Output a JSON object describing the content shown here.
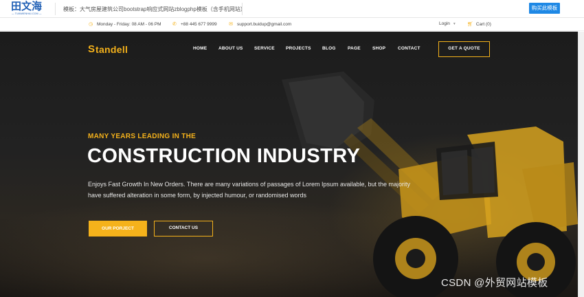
{
  "preview": {
    "logo_text": "田文海",
    "logo_sub": "— TIANWENHAI.COM —",
    "title": "模板：大气房屋建筑公司bootstrap响应式网站zblogphp模板（含手机网站）",
    "buy_label": "购买此模板"
  },
  "info": {
    "hours": "Monday - Friday: 08 AM - 06 PM",
    "phone": "+88 445 677 9999",
    "email": "support.buidup@gmail.com",
    "login": "Login",
    "cart": "Cart (0)"
  },
  "brand": {
    "name": "tandell",
    "initial": "S"
  },
  "nav": {
    "items": [
      "HOME",
      "ABOUT US",
      "SERVICE",
      "PROJECTS",
      "BLOG",
      "PAGE",
      "SHOP",
      "CONTACT"
    ]
  },
  "quote_label": "GET A QUOTE",
  "hero": {
    "eyebrow": "MANY YEARS LEADING IN THE",
    "headline": "CONSTRUCTION INDUSTRY",
    "description": "Enjoys Fast Growth In New Orders. There are many variations of passages of Lorem Ipsum available, but the majority have suffered alteration in some form, by injected humour, or randomised words",
    "primary_btn": "OUR PORJECT",
    "secondary_btn": "CONTACT US"
  },
  "watermark": "CSDN @外贸网站模板",
  "colors": {
    "accent": "#f5b21b",
    "buy_button": "#1e88e5"
  }
}
